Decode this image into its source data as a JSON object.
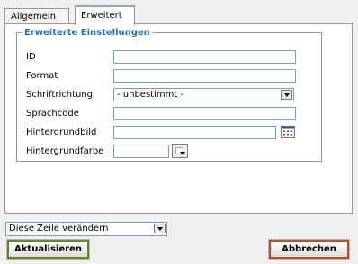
{
  "tabs": [
    {
      "label": "Allgemein",
      "active": false
    },
    {
      "label": "Erweitert",
      "active": true
    }
  ],
  "advanced": {
    "legend": "Erweiterte Einstellungen",
    "fields": {
      "id": {
        "label": "ID",
        "value": ""
      },
      "format": {
        "label": "Format",
        "value": ""
      },
      "direction": {
        "label": "Schriftrichtung",
        "value": "- unbestimmt -"
      },
      "language": {
        "label": "Sprachcode",
        "value": ""
      },
      "bgimage": {
        "label": "Hintergrundbild",
        "value": ""
      },
      "bgcolor": {
        "label": "Hintergrundfarbe",
        "value": "",
        "swatch": "#ffffff"
      }
    }
  },
  "footer": {
    "rowmode": "Diese Zeile verändern",
    "update_label": "Aktualisieren",
    "cancel_label": "Abbrechen"
  },
  "colors": {
    "legend": "#2b6fb6",
    "update_border": "#5a8a2a",
    "cancel_border": "#c04a2a"
  }
}
